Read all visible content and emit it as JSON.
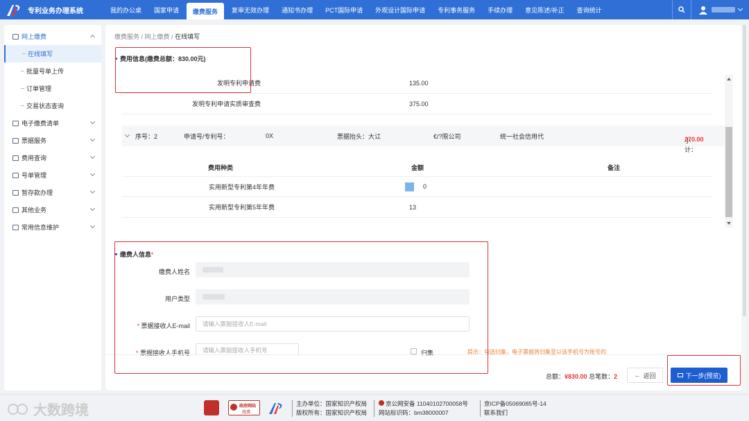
{
  "header": {
    "app_title": "专利业务办理系统",
    "nav": [
      "我的办公桌",
      "国家申请",
      "缴费服务",
      "复审无效办理",
      "通知书办理",
      "PCT国际申请",
      "外观设计国际申请",
      "专利事务服务",
      "手续办理",
      "意见陈述/补正",
      "查询统计"
    ],
    "active_nav": "缴费服务"
  },
  "sidebar": {
    "online_pay": "网上缴费",
    "subs": [
      "在线填写",
      "批量号单上传",
      "订单管理",
      "交易状态查询"
    ],
    "groups": [
      "电子缴费清单",
      "票据服务",
      "费用查询",
      "号单管理",
      "暂存款办理",
      "其他业务",
      "常用信息维护"
    ]
  },
  "breadcrumb": [
    "缴费服务",
    "网上缴费",
    "在线填写"
  ],
  "fee_info": {
    "title": "费用信息(缴费总额：830.00元)",
    "rows": [
      {
        "name": "发明专利申请费",
        "amount": "135.00"
      },
      {
        "name": "发明专利申请实质审查费",
        "amount": "375.00"
      }
    ]
  },
  "order": {
    "seq": "序号：2",
    "app_label": "申请号/专利号：",
    "app_value": "0X",
    "invoice_label": "票据抬头：大讧",
    "invoice_tail": "€/?限公司",
    "credit": "统一社会信用代",
    "subtotal_label": "小计：",
    "subtotal_value": "270.00",
    "columns": [
      "费用种类",
      "金额",
      "备注"
    ],
    "rows": [
      {
        "name": "实用新型专利第4年年费",
        "amount": "0"
      },
      {
        "name": "实用新型专利第5年年费",
        "amount": "13"
      }
    ]
  },
  "payer": {
    "title": "缴费人信息",
    "req_mark": "*",
    "name_label": "缴费人姓名",
    "type_label": "用户类型",
    "email_label": "票据接收人E-mail",
    "email_placeholder": "请输入票据接收人E-mail",
    "phone_label": "票据接收人手机号",
    "phone_placeholder": "请输入票据接收人手机号",
    "checkbox_label": "归集",
    "hint": "提示：勾选归集，电子票据将归集至以该手机号为账号的"
  },
  "footer": {
    "total_label": "总额：",
    "total_value": "¥830.00",
    "count_label": "总笔数：",
    "count_value": "2",
    "back": "返回",
    "next": "下一步(预览)"
  },
  "bottom": {
    "watermark": "大数跨境",
    "gov_badge": "政府网站",
    "gov_sub": "找错",
    "host": "主办单位：国家知识产权局",
    "copyright": "版权所有：国家知识产权局",
    "police": "京公网安备 11040102700058号",
    "site_id": "网站标识码：bm38000007",
    "icp": "京ICP备05069085号-14",
    "contact": "联系我们"
  }
}
